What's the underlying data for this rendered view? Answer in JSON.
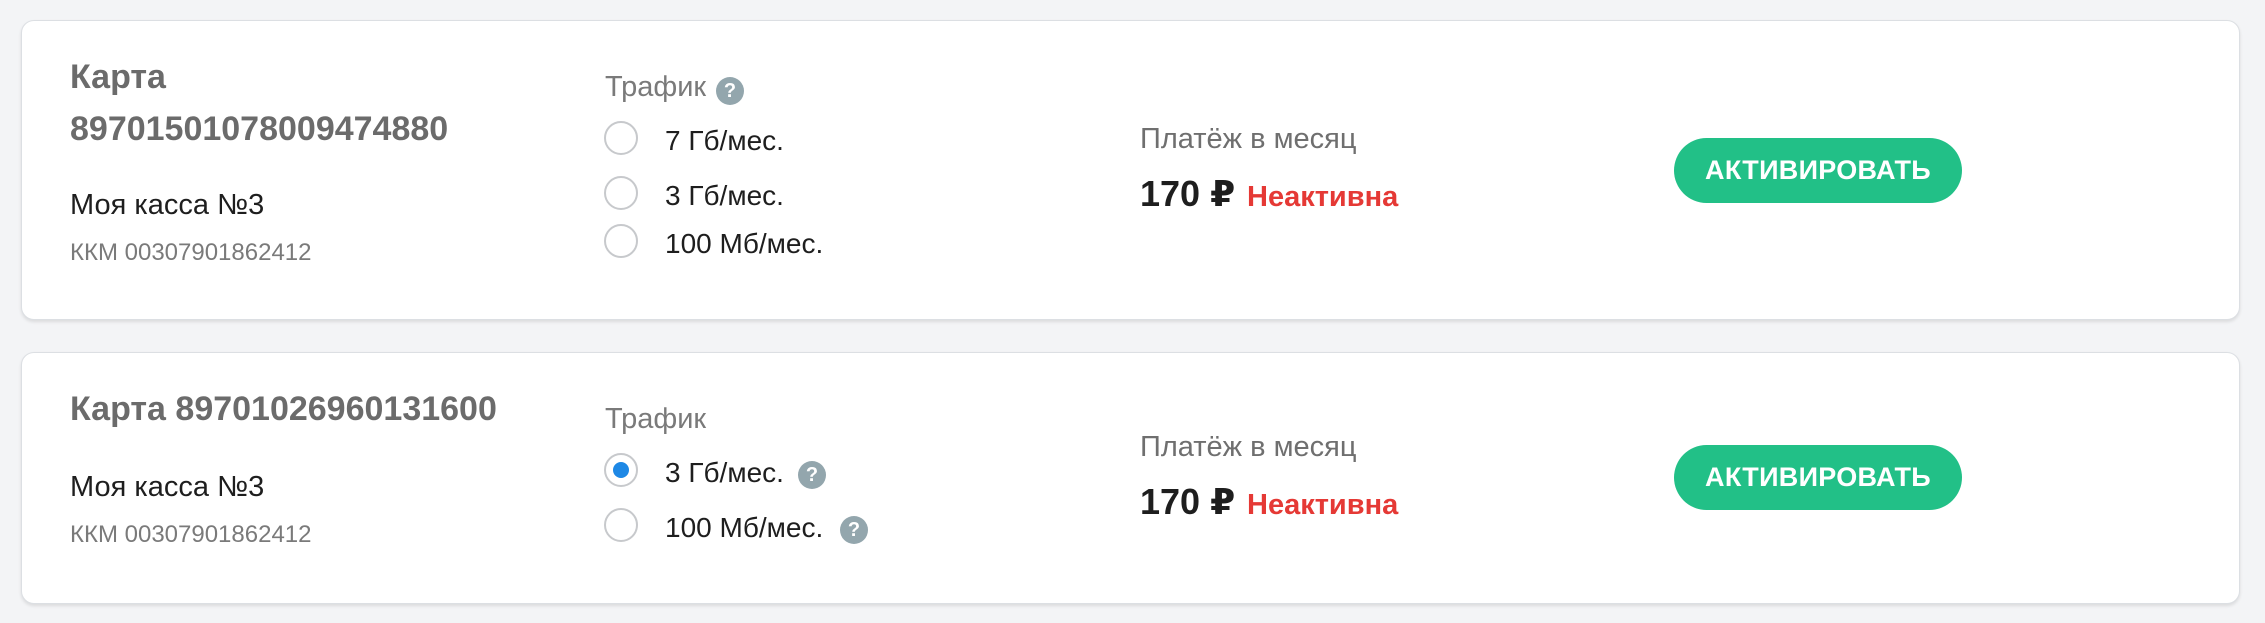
{
  "cards": [
    {
      "title": "Карта 89701501078009474880",
      "title_line1": "Карта",
      "title_line2": "89701501078009474880",
      "kassa": "Моя касса №3",
      "kkm": "ККМ 00307901862412",
      "traffic_label": "Трафик",
      "options": [
        {
          "label": "7 Гб/мес.",
          "checked": false
        },
        {
          "label": "3 Гб/мес.",
          "checked": false
        },
        {
          "label": "100 Мб/мес.",
          "checked": false
        }
      ],
      "payment_label": "Платёж в месяц",
      "price": "170 ₽",
      "status": "Неактивна",
      "button_label": "АКТИВИРОВАТЬ"
    },
    {
      "title": "Карта 89701026960131600",
      "kassa": "Моя касса №3",
      "kkm": "ККМ 00307901862412",
      "traffic_label": "Трафик",
      "options": [
        {
          "label": "3 Гб/мес.",
          "checked": true
        },
        {
          "label": "100 Мб/мес.",
          "checked": false
        }
      ],
      "payment_label": "Платёж в месяц",
      "price": "170 ₽",
      "status": "Неактивна",
      "button_label": "АКТИВИРОВАТЬ"
    }
  ],
  "help_glyph": "?",
  "colors": {
    "button": "#22c087",
    "status_inactive": "#e53935",
    "radio_checked": "#1e88e5",
    "help_icon": "#93a6ad"
  }
}
